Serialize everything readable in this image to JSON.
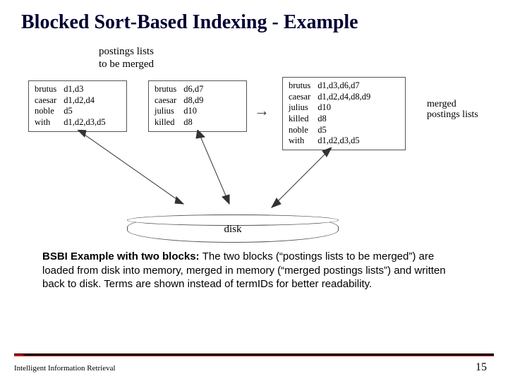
{
  "title": "Blocked Sort-Based Indexing - Example",
  "labels": {
    "top": "postings lists\nto be merged",
    "right": "merged postings lists",
    "disk": "disk"
  },
  "blocks": {
    "b1": [
      {
        "term": "brutus",
        "docs": "d1,d3"
      },
      {
        "term": "caesar",
        "docs": "d1,d2,d4"
      },
      {
        "term": "noble",
        "docs": "d5"
      },
      {
        "term": "with",
        "docs": "d1,d2,d3,d5"
      }
    ],
    "b2": [
      {
        "term": "brutus",
        "docs": "d6,d7"
      },
      {
        "term": "caesar",
        "docs": "d8,d9"
      },
      {
        "term": "julius",
        "docs": "d10"
      },
      {
        "term": "killed",
        "docs": "d8"
      }
    ],
    "b3": [
      {
        "term": "brutus",
        "docs": "d1,d3,d6,d7"
      },
      {
        "term": "caesar",
        "docs": "d1,d2,d4,d8,d9"
      },
      {
        "term": "julius",
        "docs": "d10"
      },
      {
        "term": "killed",
        "docs": "d8"
      },
      {
        "term": "noble",
        "docs": "d5"
      },
      {
        "term": "with",
        "docs": "d1,d2,d3,d5"
      }
    ]
  },
  "caption": {
    "bold": "BSBI Example with two blocks: ",
    "rest": "The two blocks (“postings lists to be merged”) are loaded from disk into memory, merged in memory (“merged postings lists”) and written back to disk. Terms are shown instead of termIDs for better readability."
  },
  "footer": {
    "left": "Intelligent Information Retrieval",
    "page": "15"
  }
}
